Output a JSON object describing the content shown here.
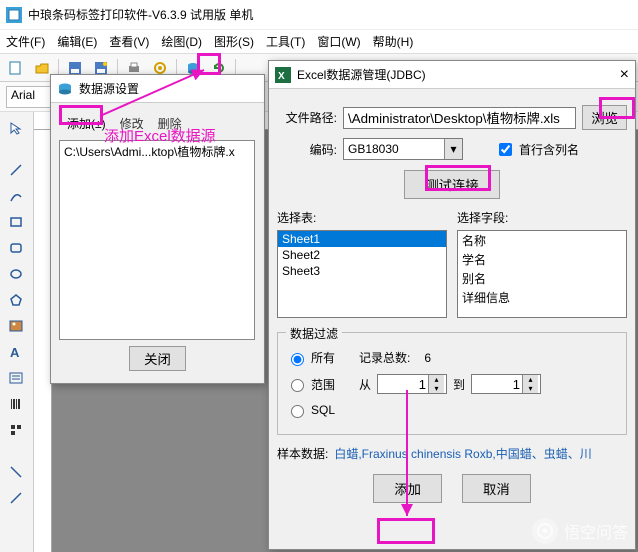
{
  "app": {
    "title": "中琅条码标签打印软件-V6.3.9 试用版 单机"
  },
  "menu": [
    "文件(F)",
    "编辑(E)",
    "查看(V)",
    "绘图(D)",
    "图形(S)",
    "工具(T)",
    "窗口(W)",
    "帮助(H)"
  ],
  "font": {
    "name": "Arial"
  },
  "ds_dialog": {
    "title": "数据源设置",
    "tabs": {
      "add": "添加(±)",
      "edit": "修改",
      "delete": "删除"
    },
    "list_item": "C:\\Users\\Admi...ktop\\植物标牌.x",
    "close": "关闭"
  },
  "jdbc": {
    "title": "Excel数据源管理(JDBC)",
    "path_label": "文件路径:",
    "path_value": "\\Administrator\\Desktop\\植物标牌.xls",
    "browse": "浏览",
    "encoding_label": "编码:",
    "encoding_value": "GB18030",
    "first_row": "首行含列名",
    "test": "测试连接",
    "select_table": "选择表:",
    "sheets": [
      "Sheet1",
      "Sheet2",
      "Sheet3"
    ],
    "select_field": "选择字段:",
    "fields": [
      "名称",
      "学名",
      "别名",
      "详细信息"
    ],
    "filter_title": "数据过滤",
    "all": "所有",
    "count_label": "记录总数:",
    "count_value": "6",
    "range": "范围",
    "from": "从",
    "to": "到",
    "from_val": "1",
    "to_val": "1",
    "sql": "SQL",
    "sample_label": "样本数据:",
    "sample_value": "白蜡,Fraxinus chinensis Roxb,中国蜡、虫蜡、川",
    "add": "添加",
    "cancel": "取消"
  },
  "annotation": "添加Excel数据源",
  "watermark": "悟空问答"
}
